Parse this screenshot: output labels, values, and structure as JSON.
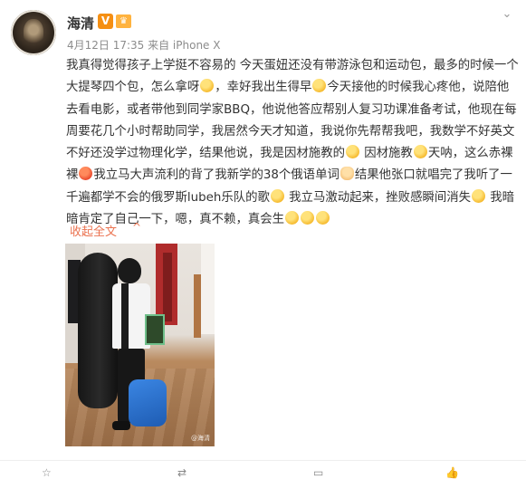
{
  "post": {
    "author": "海清",
    "vip_badge": "V",
    "level_badge": "♛",
    "meta": "4月12日 17:35 来自 iPhone X",
    "text_parts": [
      "我真得觉得孩子上学挺不容易的 今天蛋妞还没有带游泳包和运动包，最多的时候一个大提琴四个包，怎么拿呀",
      "，幸好我出生得早",
      "今天接他的时候我心疼他，说陪他去看电影，或者带他到同学家BBQ，他说他答应帮别人复习功课准备考试，他现在每周要花几个小时帮助同学，我居然今天才知道，我说你先帮帮我吧，我数学不好英文不好还没学过物理化学，结果他说，我是因材施教的",
      " 因材施教",
      "天呐，这么赤裸裸",
      "我立马大声流利的背了我新学的38个俄语单词",
      "结果他张口就唱完了我听了一千遍都学不会的俄罗斯lubeh乐队的歌",
      " 我立马激动起来，挫败感瞬间消失",
      " 我暗暗肯定了自己一下，嗯，真不赖，真会生"
    ],
    "collapse_label": "收起全文",
    "collapse_arrow": "^",
    "photo_watermark": "@海清"
  },
  "icons": {
    "menu": "chevron-down-icon",
    "emoji": "emoji-icon"
  },
  "colors": {
    "accent": "#eb7350",
    "vip": "#f58f13"
  }
}
